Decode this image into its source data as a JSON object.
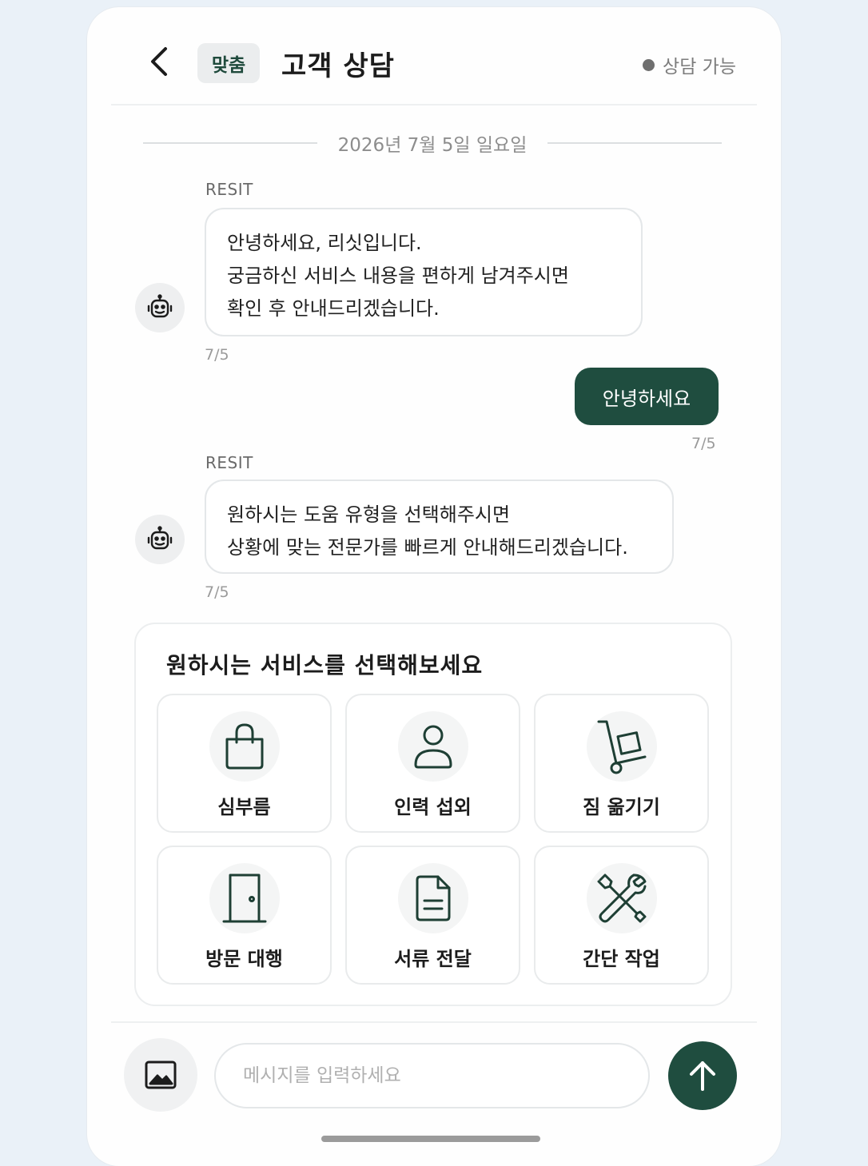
{
  "header": {
    "tag": "맞춤",
    "title": "고객 상담",
    "status": "상담 가능"
  },
  "date": "2026년 7월 5일 일요일",
  "messages": [
    {
      "sender": "RESIT",
      "lines": [
        "안녕하세요, 리싯입니다.",
        "궁금하신 서비스 내용을 편하게 남겨주시면",
        "확인 후 안내드리겠습니다."
      ],
      "time": "7/5"
    },
    {
      "text": "안녕하세요",
      "time": "7/5"
    },
    {
      "sender": "RESIT",
      "lines": [
        "원하시는 도움 유형을 선택해주시면",
        "상황에 맞는 전문가를 빠르게 안내해드리겠습니다."
      ],
      "time": "7/5"
    }
  ],
  "services": {
    "title": "원하시는 서비스를 선택해보세요",
    "items": [
      {
        "label": "심부름",
        "icon": "shopping-bag-icon"
      },
      {
        "label": "인력 섭외",
        "icon": "person-icon"
      },
      {
        "label": "짐 옮기기",
        "icon": "hand-truck-icon"
      },
      {
        "label": "방문 대행",
        "icon": "door-icon"
      },
      {
        "label": "서류 전달",
        "icon": "document-icon"
      },
      {
        "label": "간단 작업",
        "icon": "tools-icon"
      }
    ]
  },
  "composer": {
    "placeholder": "메시지를 입력하세요"
  },
  "colors": {
    "brand": "#1f4d3f",
    "background": "#eaf1f8"
  }
}
